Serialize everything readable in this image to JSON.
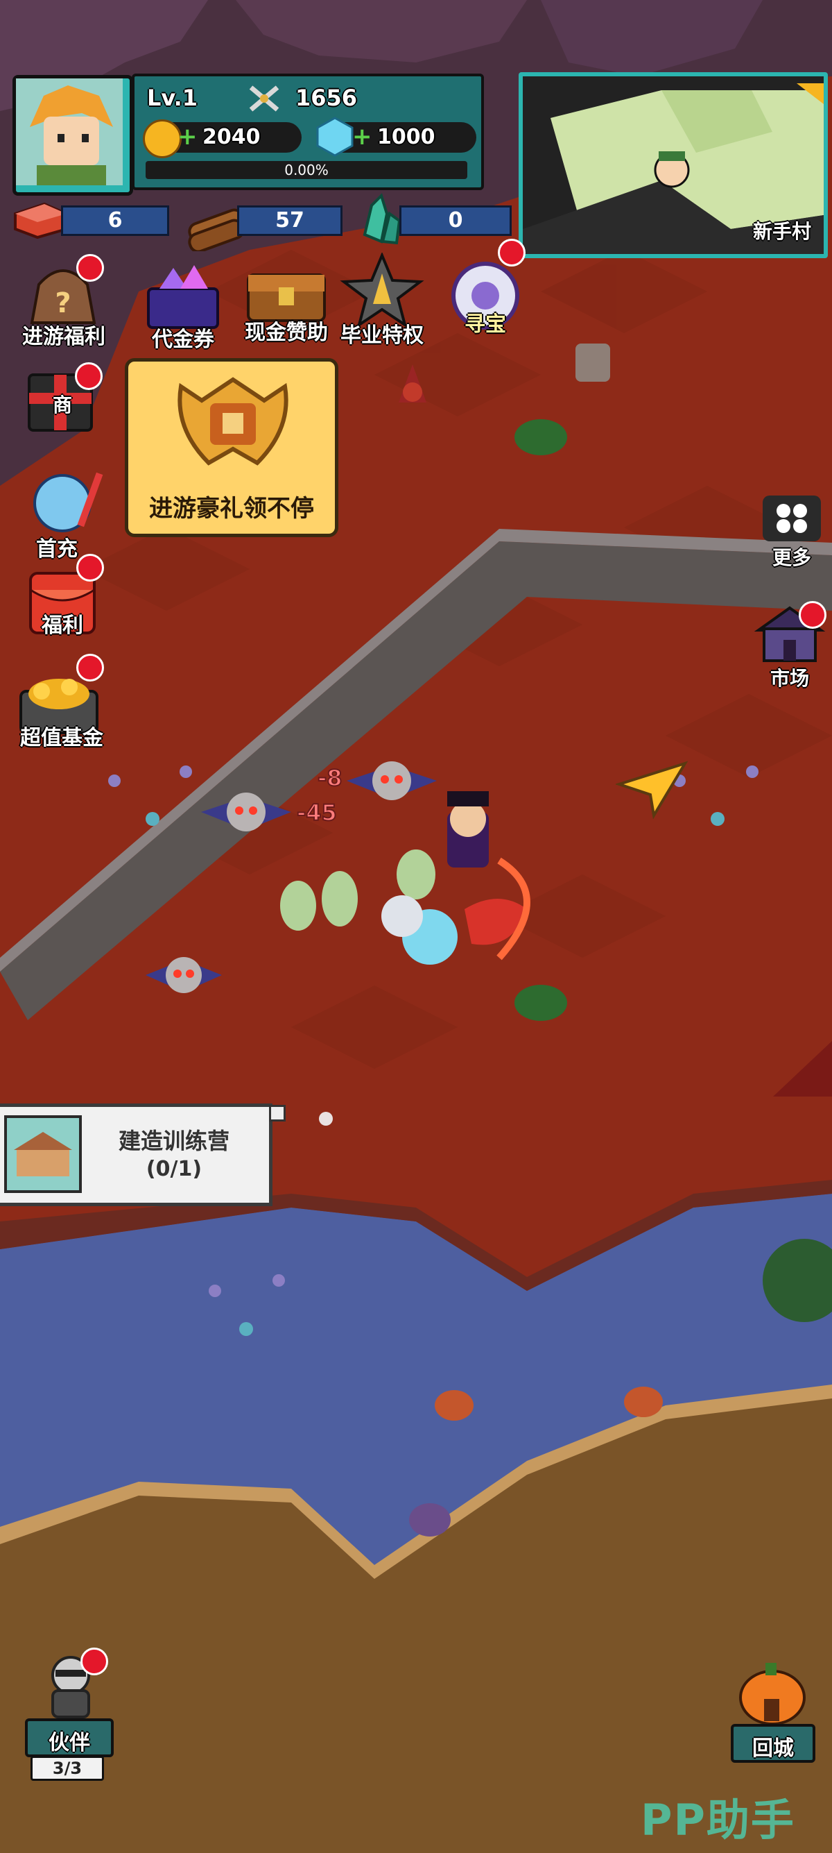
{
  "player": {
    "level": "Lv.1",
    "power": "1656",
    "gold": "2040",
    "diamonds": "1000",
    "exp_percent": "0.00%"
  },
  "resources": {
    "meat": "6",
    "wood": "57",
    "crystal": "0"
  },
  "minimap": {
    "location": "新手村"
  },
  "left_menu": {
    "enter_welfare": "进游福利",
    "voucher": "代金券",
    "cash_support": "现金赞助",
    "graduation": "毕业特权",
    "treasure": "寻宝",
    "shop": "商",
    "first_charge": "首充",
    "welfare": "福利",
    "value_fund": "超值基金"
  },
  "promo": {
    "text": "进游豪礼领不停"
  },
  "right_menu": {
    "more": "更多",
    "market": "市场"
  },
  "damage": {
    "a": "-8",
    "b": "-45"
  },
  "quest": {
    "title": "建造训练营",
    "progress": "(0/1)"
  },
  "bottom": {
    "partner": "伙伴",
    "partner_count": "3/3",
    "return_city": "回城"
  },
  "watermark": "PP助手",
  "colors": {
    "ground_red": "#8e2a18",
    "path_gray": "#5b5553",
    "water": "#4e5fa0",
    "sand": "#7a5428",
    "hud_teal": "#1f6f71",
    "notify_red": "#e4172a"
  }
}
